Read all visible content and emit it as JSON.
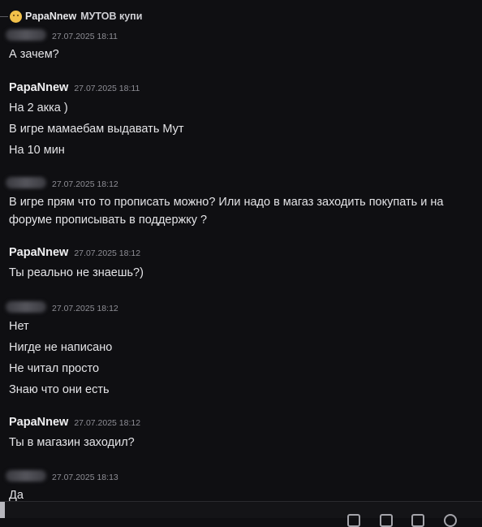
{
  "reply": {
    "author": "PapaNnew",
    "text": "МУТОВ купи"
  },
  "messages": [
    {
      "author": "",
      "time": "27.07.2025 18:11",
      "lines": [
        "А зачем?"
      ]
    },
    {
      "author": "PapaNnew",
      "time": "27.07.2025 18:11",
      "lines": [
        "На 2 акка )",
        "В игре мамаебам выдавать Мут",
        "На 10 мин"
      ]
    },
    {
      "author": "",
      "time": "27.07.2025 18:12",
      "lines": [
        "В игре прям что то прописать можно? Или надо в магаз заходить покупать и на форуме прописывать в поддержку ?"
      ]
    },
    {
      "author": "PapaNnew",
      "time": "27.07.2025 18:12",
      "lines": [
        "Ты реально не знаешь?)"
      ]
    },
    {
      "author": "",
      "time": "27.07.2025 18:12",
      "lines": [
        "Нет",
        "Нигде не написано",
        "Не читал просто",
        "Знаю что они есть"
      ]
    },
    {
      "author": "PapaNnew",
      "time": "27.07.2025 18:12",
      "lines": [
        "Ты в магазин заходил?"
      ]
    },
    {
      "author": "",
      "time": "27.07.2025 18:13",
      "lines": [
        "Да"
      ]
    }
  ]
}
